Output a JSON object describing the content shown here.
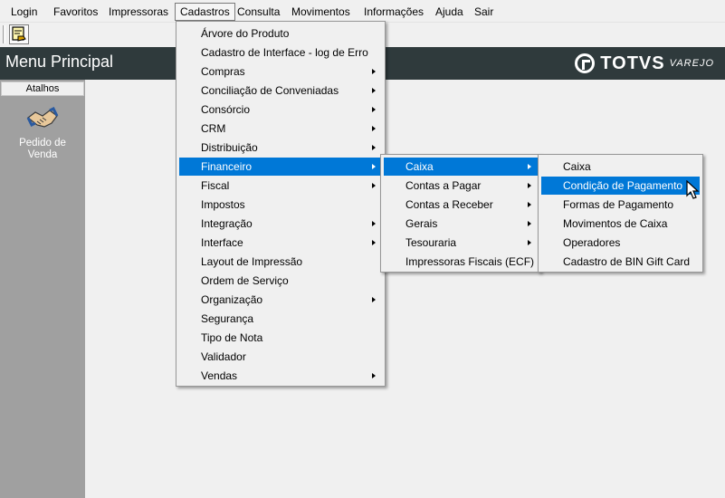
{
  "menubar": {
    "items": [
      "Login",
      "Favoritos",
      "Impressoras",
      "Cadastros",
      "Consulta",
      "Movimentos",
      "Informações",
      "Ajuda",
      "Sair"
    ]
  },
  "header": {
    "title": "Menu Principal",
    "logo_text": "TOTVS",
    "logo_sub": "VAREJO"
  },
  "sidebar": {
    "section": "Atalhos",
    "shortcut_line1": "Pedido de",
    "shortcut_line2": "Venda",
    "shortcut_icon": "handshake-icon"
  },
  "cadastros_menu": {
    "items": [
      {
        "label": "Árvore do Produto",
        "submenu": false
      },
      {
        "label": "Cadastro de Interface - log de Erro",
        "submenu": false
      },
      {
        "label": "Compras",
        "submenu": true
      },
      {
        "label": "Conciliação de Conveniadas",
        "submenu": true
      },
      {
        "label": "Consórcio",
        "submenu": true
      },
      {
        "label": "CRM",
        "submenu": true
      },
      {
        "label": "Distribuição",
        "submenu": true
      },
      {
        "label": "Financeiro",
        "submenu": true,
        "selected": true
      },
      {
        "label": "Fiscal",
        "submenu": true
      },
      {
        "label": "Impostos",
        "submenu": false
      },
      {
        "label": "Integração",
        "submenu": true
      },
      {
        "label": "Interface",
        "submenu": true
      },
      {
        "label": "Layout de Impressão",
        "submenu": false
      },
      {
        "label": "Ordem de Serviço",
        "submenu": false
      },
      {
        "label": "Organização",
        "submenu": true
      },
      {
        "label": "Segurança",
        "submenu": false
      },
      {
        "label": "Tipo de Nota",
        "submenu": false
      },
      {
        "label": "Validador",
        "submenu": false
      },
      {
        "label": "Vendas",
        "submenu": true
      }
    ]
  },
  "financeiro_menu": {
    "items": [
      {
        "label": "Caixa",
        "submenu": true,
        "selected": true
      },
      {
        "label": "Contas a Pagar",
        "submenu": true
      },
      {
        "label": "Contas a Receber",
        "submenu": true
      },
      {
        "label": "Gerais",
        "submenu": true
      },
      {
        "label": "Tesouraria",
        "submenu": true
      },
      {
        "label": "Impressoras Fiscais (ECF)",
        "submenu": false
      }
    ]
  },
  "caixa_menu": {
    "items": [
      {
        "label": "Caixa"
      },
      {
        "label": "Condição de Pagamento",
        "hovered": true
      },
      {
        "label": "Formas de Pagamento"
      },
      {
        "label": "Movimentos de Caixa"
      },
      {
        "label": "Operadores"
      },
      {
        "label": "Cadastro de BIN Gift Card"
      }
    ]
  },
  "colors": {
    "selection": "#0078d7",
    "header_bg": "#2f3a3c",
    "sidebar_bg": "#a0a0a0"
  }
}
